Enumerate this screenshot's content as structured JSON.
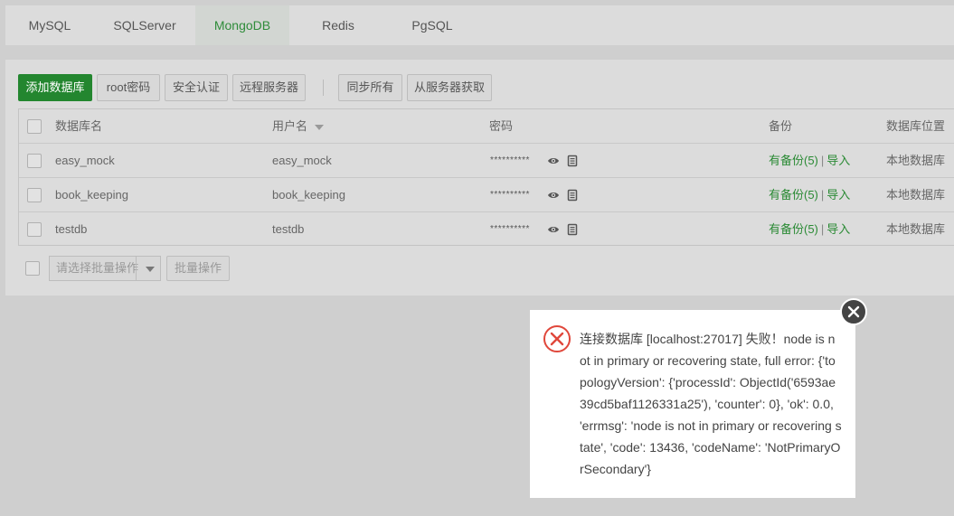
{
  "tabs": [
    {
      "label": "MySQL"
    },
    {
      "label": "SQLServer"
    },
    {
      "label": "MongoDB",
      "active": true
    },
    {
      "label": "Redis"
    },
    {
      "label": "PgSQL"
    }
  ],
  "toolbar": {
    "add_db": "添加数据库",
    "root_password": "root密码",
    "security_auth": "安全认证",
    "remote_server": "远程服务器",
    "sync_all": "同步所有",
    "fetch_from_server": "从服务器获取"
  },
  "table": {
    "headers": {
      "db_name": "数据库名",
      "username": "用户名",
      "password": "密码",
      "backup": "备份",
      "location": "数据库位置"
    },
    "rows": [
      {
        "db_name": "easy_mock",
        "username": "easy_mock",
        "password": "**********",
        "backup": "有备份(5)",
        "import": "导入",
        "location": "本地数据库"
      },
      {
        "db_name": "book_keeping",
        "username": "book_keeping",
        "password": "**********",
        "backup": "有备份(5)",
        "import": "导入",
        "location": "本地数据库"
      },
      {
        "db_name": "testdb",
        "username": "testdb",
        "password": "**********",
        "backup": "有备份(5)",
        "import": "导入",
        "location": "本地数据库"
      }
    ]
  },
  "footer": {
    "batch_select_placeholder": "请选择批量操作",
    "batch_button": "批量操作"
  },
  "dialog": {
    "message": "连接数据库 [localhost:27017] 失败！node is not in primary or recovering state, full error: {'topologyVersion': {'processId': ObjectId('6593ae39cd5baf1126331a25'), 'counter': 0}, 'ok': 0.0, 'errmsg': 'node is not in primary or recovering state', 'code': 13436, 'codeName': 'NotPrimaryOrSecondary'}"
  },
  "colors": {
    "accent": "#23862f",
    "error": "#e0473b",
    "link": "#2a8a34"
  }
}
